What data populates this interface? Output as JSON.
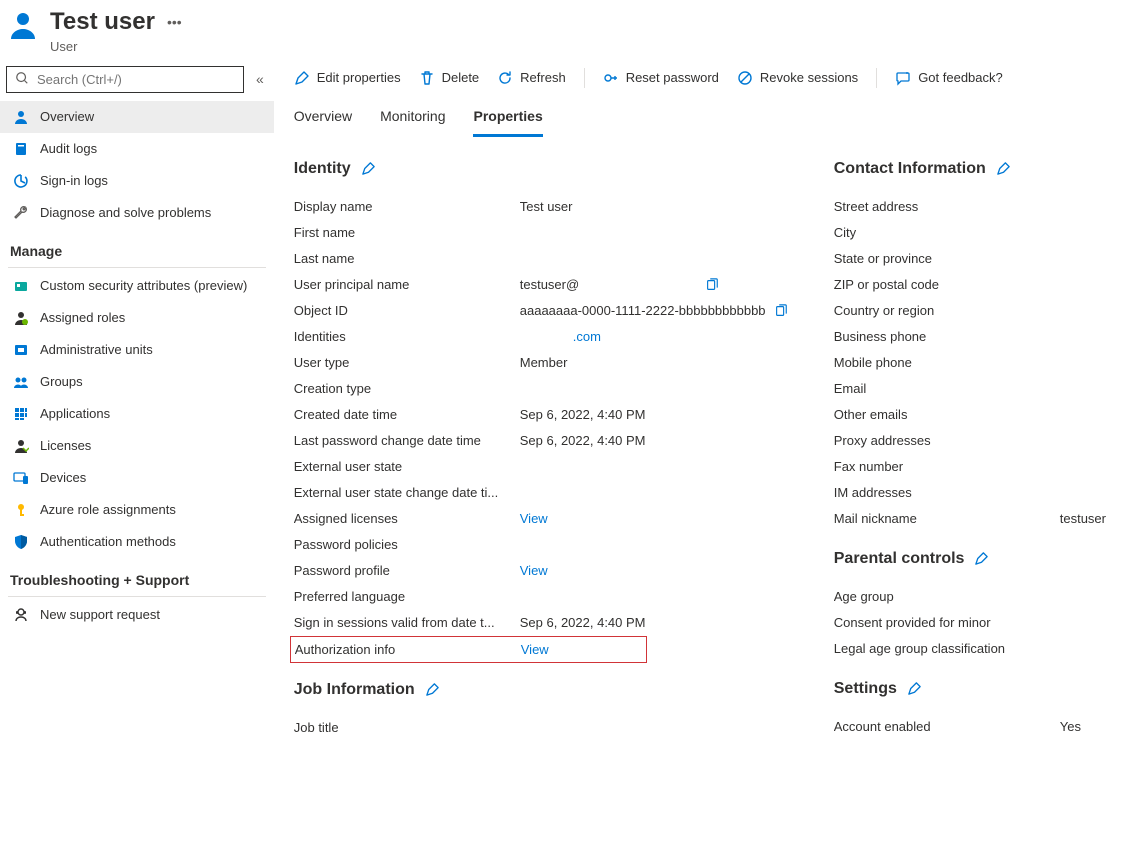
{
  "header": {
    "title": "Test user",
    "subtitle": "User"
  },
  "search": {
    "placeholder": "Search (Ctrl+/)"
  },
  "sidebar": {
    "primary": [
      {
        "label": "Overview",
        "icon": "person"
      },
      {
        "label": "Audit logs",
        "icon": "book"
      },
      {
        "label": "Sign-in logs",
        "icon": "signin"
      },
      {
        "label": "Diagnose and solve problems",
        "icon": "wrench"
      }
    ],
    "manage_title": "Manage",
    "manage": [
      {
        "label": "Custom security attributes (preview)",
        "icon": "badge"
      },
      {
        "label": "Assigned roles",
        "icon": "roles"
      },
      {
        "label": "Administrative units",
        "icon": "adminunits"
      },
      {
        "label": "Groups",
        "icon": "groups"
      },
      {
        "label": "Applications",
        "icon": "apps"
      },
      {
        "label": "Licenses",
        "icon": "licenses"
      },
      {
        "label": "Devices",
        "icon": "devices"
      },
      {
        "label": "Azure role assignments",
        "icon": "key"
      },
      {
        "label": "Authentication methods",
        "icon": "shield"
      }
    ],
    "support_title": "Troubleshooting + Support",
    "support": [
      {
        "label": "New support request",
        "icon": "support"
      }
    ]
  },
  "toolbar": {
    "edit": "Edit properties",
    "delete": "Delete",
    "refresh": "Refresh",
    "reset": "Reset password",
    "revoke": "Revoke sessions",
    "feedback": "Got feedback?"
  },
  "tabs": {
    "overview": "Overview",
    "monitoring": "Monitoring",
    "properties": "Properties"
  },
  "sections": {
    "identity": "Identity",
    "job": "Job Information",
    "contact": "Contact Information",
    "parental": "Parental controls",
    "settings": "Settings"
  },
  "identity": {
    "display_name": {
      "label": "Display name",
      "value": "Test user"
    },
    "first_name": {
      "label": "First name",
      "value": ""
    },
    "last_name": {
      "label": "Last name",
      "value": ""
    },
    "upn": {
      "label": "User principal name",
      "value": "testuser@"
    },
    "object_id": {
      "label": "Object ID",
      "value": "aaaaaaaa-0000-1111-2222-bbbbbbbbbbbb"
    },
    "identities": {
      "label": "Identities",
      "value": ".com"
    },
    "user_type": {
      "label": "User type",
      "value": "Member"
    },
    "creation_type": {
      "label": "Creation type",
      "value": ""
    },
    "created": {
      "label": "Created date time",
      "value": "Sep 6, 2022, 4:40 PM"
    },
    "last_pw": {
      "label": "Last password change date time",
      "value": "Sep 6, 2022, 4:40 PM"
    },
    "ext_state": {
      "label": "External user state",
      "value": ""
    },
    "ext_state_change": {
      "label": "External user state change date ti...",
      "value": ""
    },
    "assigned_licenses": {
      "label": "Assigned licenses",
      "value": "View"
    },
    "pw_policies": {
      "label": "Password policies",
      "value": ""
    },
    "pw_profile": {
      "label": "Password profile",
      "value": "View"
    },
    "pref_lang": {
      "label": "Preferred language",
      "value": ""
    },
    "sign_sessions": {
      "label": "Sign in sessions valid from date t...",
      "value": "Sep 6, 2022, 4:40 PM"
    },
    "auth_info": {
      "label": "Authorization info",
      "value": "View"
    }
  },
  "job": {
    "job_title": {
      "label": "Job title",
      "value": ""
    }
  },
  "contact": {
    "street": {
      "label": "Street address"
    },
    "city": {
      "label": "City"
    },
    "state": {
      "label": "State or province"
    },
    "zip": {
      "label": "ZIP or postal code"
    },
    "country": {
      "label": "Country or region"
    },
    "bphone": {
      "label": "Business phone"
    },
    "mphone": {
      "label": "Mobile phone"
    },
    "email": {
      "label": "Email"
    },
    "oemails": {
      "label": "Other emails"
    },
    "proxy": {
      "label": "Proxy addresses"
    },
    "fax": {
      "label": "Fax number"
    },
    "im": {
      "label": "IM addresses"
    },
    "nickname": {
      "label": "Mail nickname",
      "value": "testuser"
    }
  },
  "parental": {
    "age": {
      "label": "Age group"
    },
    "consent": {
      "label": "Consent provided for minor"
    },
    "legal": {
      "label": "Legal age group classification"
    }
  },
  "settings": {
    "enabled": {
      "label": "Account enabled",
      "value": "Yes"
    }
  }
}
